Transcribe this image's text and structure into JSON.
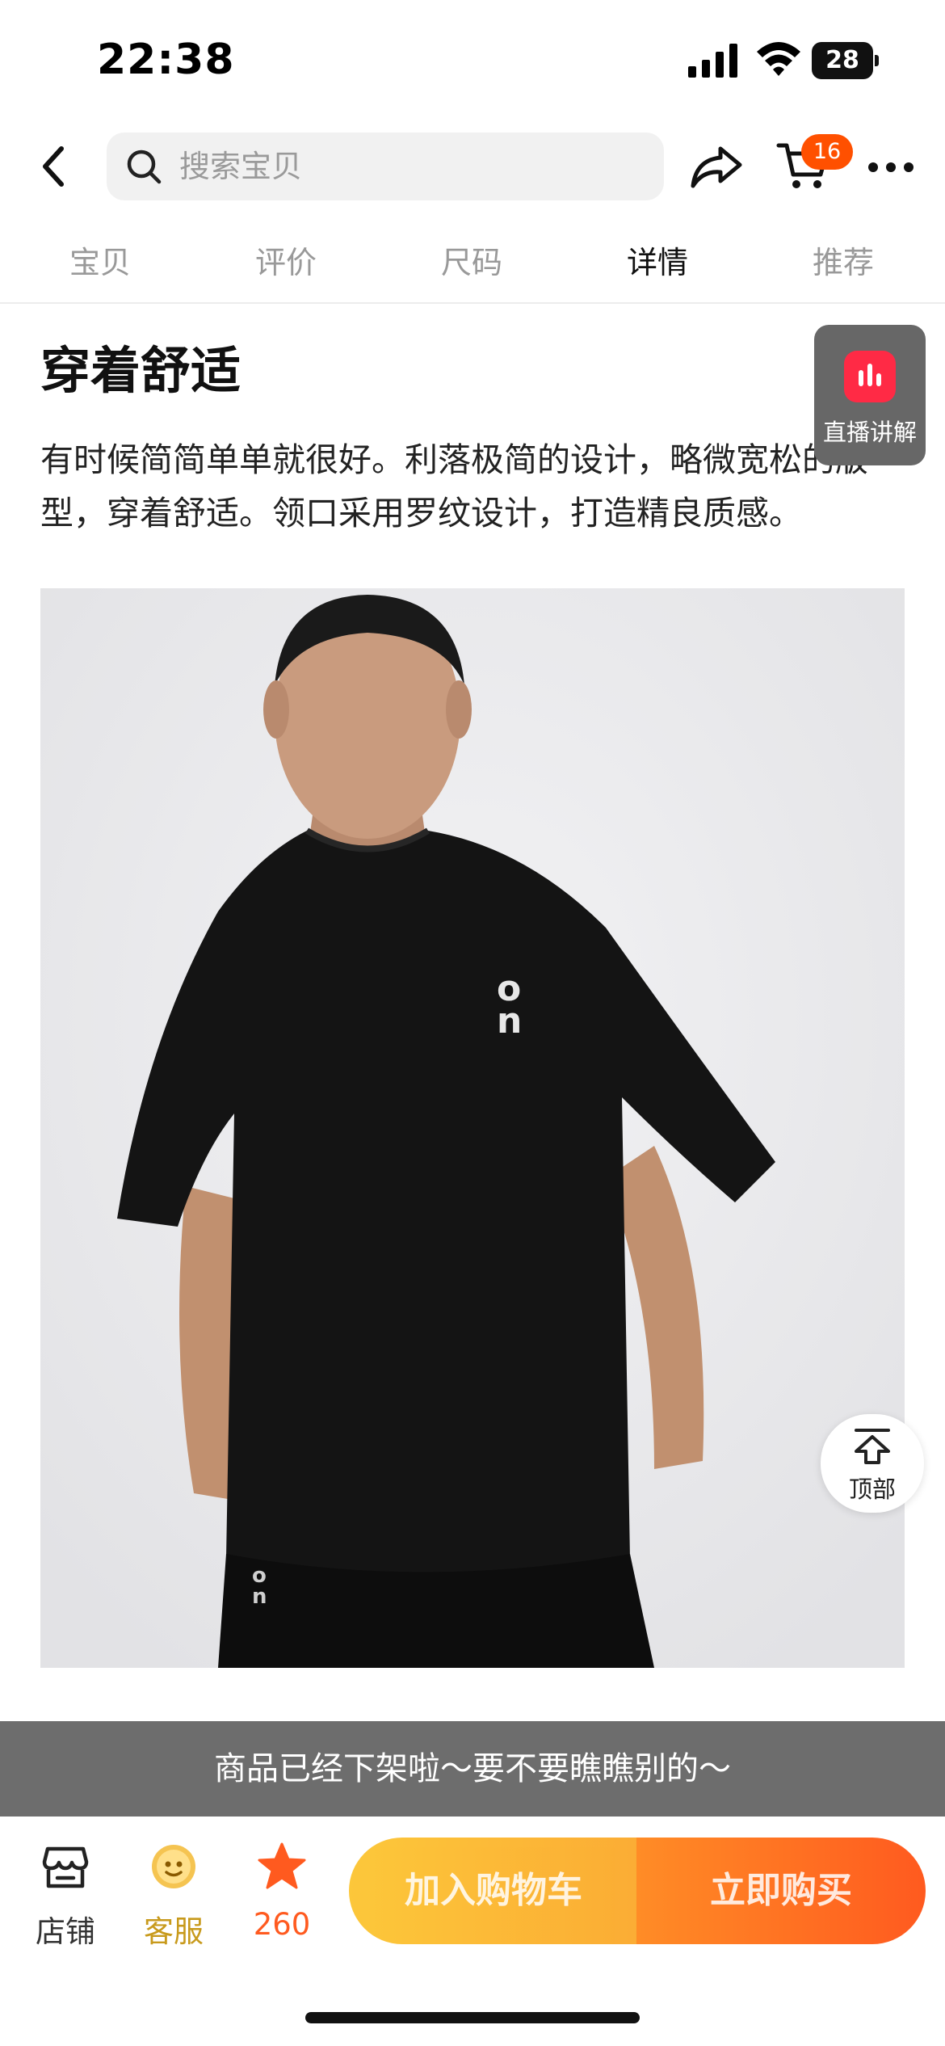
{
  "status_bar": {
    "time": "22:38",
    "battery": "28"
  },
  "nav": {
    "search_placeholder": "搜索宝贝",
    "cart_count": "16"
  },
  "tabs": [
    {
      "label": "宝贝",
      "active": false
    },
    {
      "label": "评价",
      "active": false
    },
    {
      "label": "尺码",
      "active": false
    },
    {
      "label": "详情",
      "active": true
    },
    {
      "label": "推荐",
      "active": false
    }
  ],
  "content": {
    "title": "穿着舒适",
    "description": "有时候简简单单就很好。利落极简的设计，略微宽松的版型，穿着舒适。领口采用罗纹设计，打造精良质感。",
    "live_label": "直播讲解",
    "top_label": "顶部"
  },
  "banner": {
    "text": "商品已经下架啦～要不要瞧瞧别的～"
  },
  "bottom_bar": {
    "store_label": "店铺",
    "service_label": "客服",
    "favorite_count": "260",
    "add_to_cart_label": "加入购物车",
    "buy_now_label": "立即购买"
  },
  "colors": {
    "accent": "#ff5000",
    "favorite": "#ff5a1f",
    "service": "#d4a017",
    "live": "#ff2a45"
  },
  "icons": [
    "back-arrow-icon",
    "search-icon",
    "share-icon",
    "cart-icon",
    "more-icon",
    "live-icon",
    "top-arrow-icon",
    "store-icon",
    "service-icon",
    "star-icon"
  ]
}
